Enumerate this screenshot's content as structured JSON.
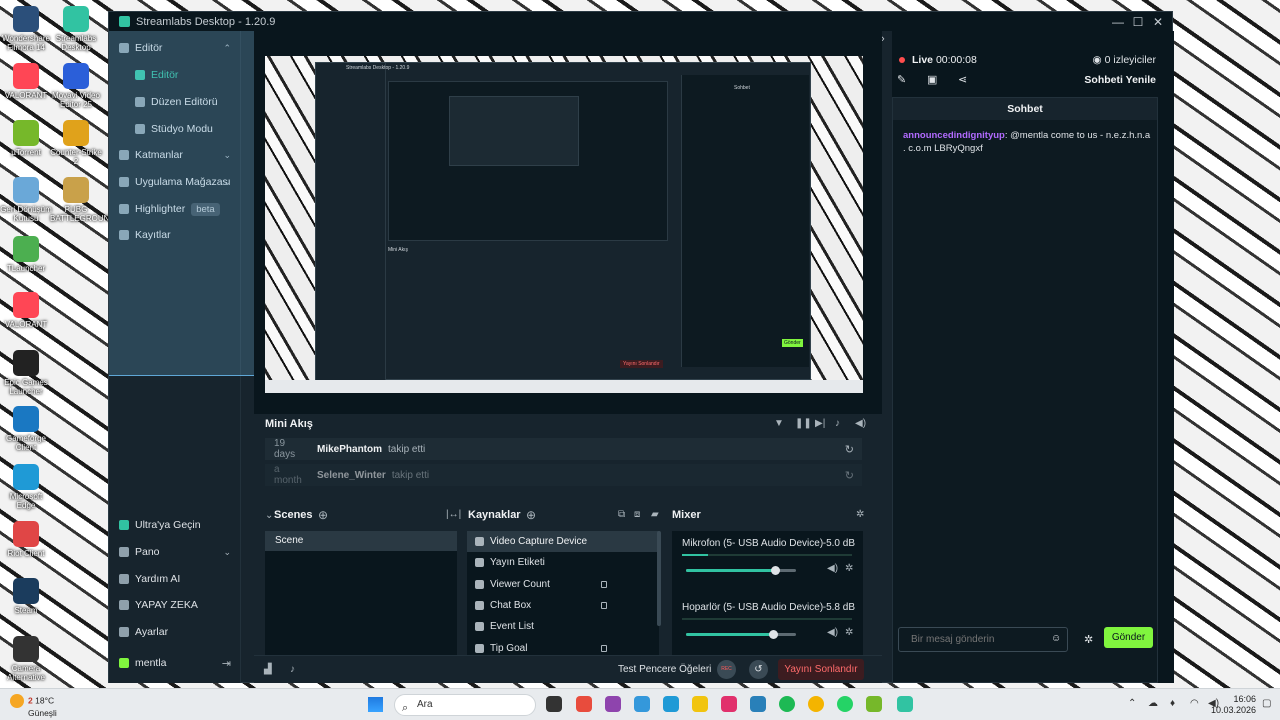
{
  "desktop_icons": [
    {
      "label": "Wondershare Filmora 14",
      "color": "#2b4f7a"
    },
    {
      "label": "Streamlabs Desktop",
      "color": "#31c3a2"
    },
    {
      "label": "VALORANT",
      "color": "#ff4655"
    },
    {
      "label": "Movavi Video Editor 25",
      "color": "#2b5fd9"
    },
    {
      "label": "µTorrent",
      "color": "#76b82a"
    },
    {
      "label": "Counter-Strike 2",
      "color": "#e0a21b"
    },
    {
      "label": "Geri Dönüşüm Kutusu",
      "color": "#6aa8d8"
    },
    {
      "label": "PUBG BATTLEGROUNDS",
      "color": "#c9a14a"
    },
    {
      "label": "TLauncher",
      "color": "#4caf50"
    },
    {
      "label": "VALORANT",
      "color": "#ff4655"
    },
    {
      "label": "Epic Games Launcher",
      "color": "#222222"
    },
    {
      "label": "Gameforge Client",
      "color": "#1a78c2"
    },
    {
      "label": "Microsoft Edge",
      "color": "#1f9ad6"
    },
    {
      "label": "Riot Client",
      "color": "#e04646"
    },
    {
      "label": "Steam",
      "color": "#1b3c5d"
    },
    {
      "label": "Camera Alternative",
      "color": "#333333"
    }
  ],
  "window": {
    "title": "Streamlabs Desktop - 1.20.9",
    "minimize": "—",
    "maximize": "☐",
    "close": "✕"
  },
  "sidebar": {
    "items": [
      {
        "label": "Editör",
        "chevron": "⌃"
      },
      {
        "label": "Editör"
      },
      {
        "label": "Düzen Editörü"
      },
      {
        "label": "Stüdyo Modu"
      },
      {
        "label": "Katmanlar",
        "chevron": "⌄"
      },
      {
        "label": "Uygulama Mağazası",
        "chevron": "⌄"
      },
      {
        "label": "Highlighter",
        "badge": "beta"
      },
      {
        "label": "Kayıtlar"
      }
    ],
    "bottom_items": [
      {
        "label": "Ultra'ya Geçin"
      },
      {
        "label": "Pano",
        "chevron": "⌄"
      },
      {
        "label": "Yardım AI"
      },
      {
        "label": "YAPAY ZEKA"
      },
      {
        "label": "Ayarlar"
      },
      {
        "label": "mentla"
      }
    ]
  },
  "mini_akis": {
    "title": "Mini Akış",
    "rows": [
      {
        "ago": "19 days",
        "user": "MikePhantom",
        "action": "takip etti"
      },
      {
        "ago": "a month",
        "user": "Selene_Winter",
        "action": "takip etti"
      }
    ]
  },
  "scenes": {
    "title": "Scenes",
    "items": [
      "Scene"
    ]
  },
  "sources": {
    "title": "Kaynaklar",
    "items": [
      {
        "label": "Video Capture Device",
        "selected": true,
        "locked": false
      },
      {
        "label": "Yayın Etiketi",
        "locked": false
      },
      {
        "label": "Viewer Count",
        "locked": true
      },
      {
        "label": "Chat Box",
        "locked": true
      },
      {
        "label": "Event List",
        "locked": false
      },
      {
        "label": "Tip Goal",
        "locked": true
      }
    ]
  },
  "mixer": {
    "title": "Mixer",
    "channels": [
      {
        "name": "Mikrofon (5- USB Audio Device)",
        "db": "-5.0 dB",
        "volume": 0.81,
        "level": 0.15
      },
      {
        "name": "Hoparlör (5- USB Audio Device)",
        "db": "-5.8 dB",
        "volume": 0.79,
        "level": 0.0
      }
    ]
  },
  "footer": {
    "test_label": "Test Pencere Öğeleri",
    "rec_label": "REC",
    "end_label": "Yayını Sonlandır"
  },
  "right_panel": {
    "live_label": "Live",
    "live_time": "00:00:08",
    "viewers": "0 izleyiciler",
    "refresh_chat": "Sohbeti Yenile",
    "chat_title": "Sohbet",
    "message_user": "announcedindignityup",
    "message_text": ": @mentla come to us - n.e.z.h.n.a . c.o.m LBRyQngxf",
    "input_placeholder": "Bir mesaj gönderin",
    "send_label": "Gönder"
  },
  "preview_mini": {
    "title": "Streamlabs Desktop - 1.20.9",
    "mini_akis": "Mini Akış",
    "chat": "Sohbet",
    "end": "Yayını Sonlandır",
    "send": "Gönder"
  },
  "taskbar": {
    "weather_temp": "18°C",
    "weather_desc": "Güneşli",
    "weather_badge": "2",
    "search_text": "Ara",
    "time": "16:06",
    "date": "10.03.2026"
  }
}
